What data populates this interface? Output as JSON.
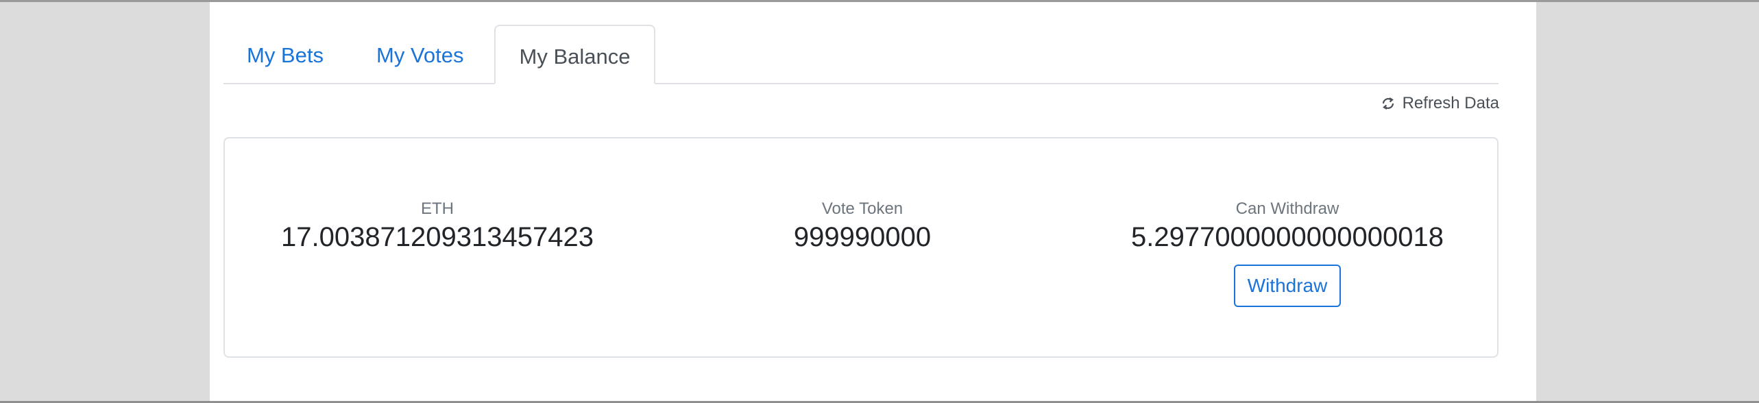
{
  "tabs": [
    {
      "label": "My Bets",
      "active": false
    },
    {
      "label": "My Votes",
      "active": false
    },
    {
      "label": "My Balance",
      "active": true
    }
  ],
  "refresh": {
    "label": "Refresh Data",
    "icon": "refresh-icon"
  },
  "balances": {
    "eth": {
      "label": "ETH",
      "value": "17.003871209313457423"
    },
    "vote_token": {
      "label": "Vote Token",
      "value": "999990000"
    },
    "can_withdraw": {
      "label": "Can Withdraw",
      "value": "5.2977000000000000018"
    }
  },
  "withdraw_button": {
    "label": "Withdraw"
  },
  "colors": {
    "link": "#1a73d9",
    "text": "#212529",
    "muted": "#6c757d",
    "border": "#dee2e6",
    "background": "#dcdcdc"
  }
}
